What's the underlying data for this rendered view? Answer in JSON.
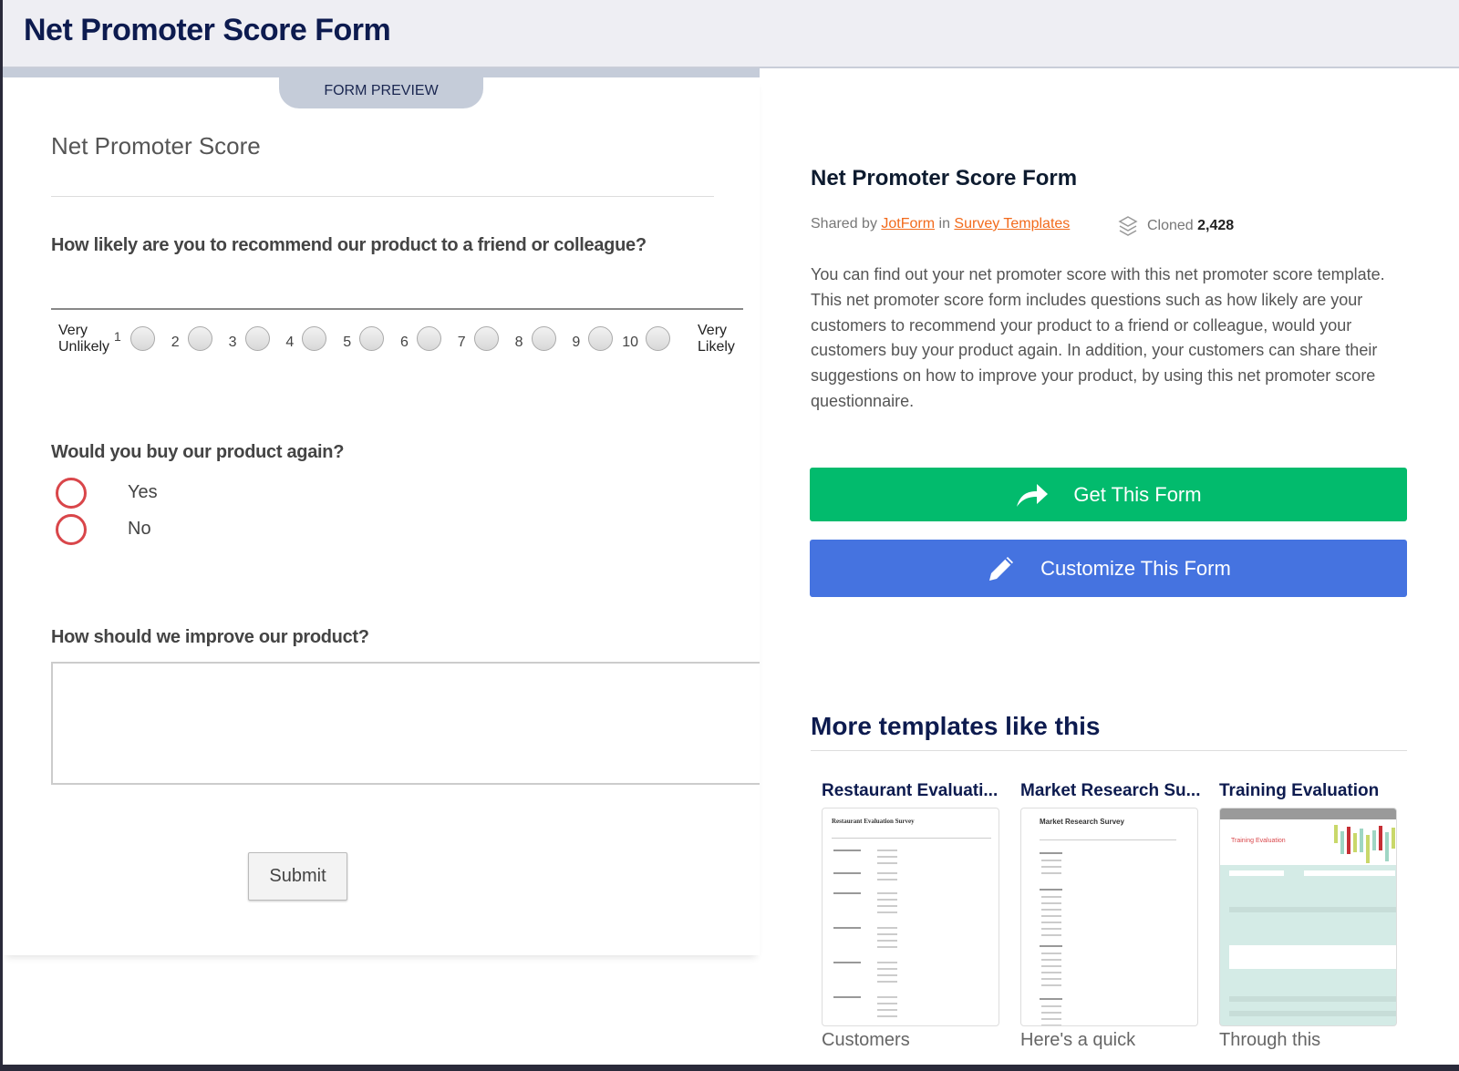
{
  "header": {
    "title": "Net Promoter Score Form"
  },
  "preview": {
    "tab_label": "FORM PREVIEW",
    "form_title": "Net Promoter Score",
    "q1": {
      "label": "How likely are you to recommend our product to a friend or colleague?",
      "low_label_1": "Very",
      "low_label_2": "Unlikely",
      "high_label_1": "Very",
      "high_label_2": "Likely",
      "options": [
        "1",
        "2",
        "3",
        "4",
        "5",
        "6",
        "7",
        "8",
        "9",
        "10"
      ]
    },
    "q2": {
      "label": "Would you buy our product again?",
      "options": [
        "Yes",
        "No"
      ],
      "accent": "#d9464a"
    },
    "q3": {
      "label": "How should we improve our product?",
      "value": ""
    },
    "submit_label": "Submit"
  },
  "details": {
    "title": "Net Promoter Score Form",
    "shared_by_prefix": "Shared by",
    "author": "JotForm",
    "in_word": "in",
    "category": "Survey Templates",
    "cloned_label": "Cloned",
    "cloned_count": "2,428",
    "description": "You can find out your net promoter score with this net promoter score template. This net promoter score form includes questions such as how likely are your customers to recommend your product to a friend or colleague, would your customers buy your product again. In addition, your customers can share their suggestions on how to improve your product, by using this net promoter score questionnaire.",
    "get_label": "Get This Form",
    "customize_label": "Customize This Form",
    "colors": {
      "get": "#02bb6d",
      "customize": "#4573e0",
      "link": "#f26a1b"
    }
  },
  "more": {
    "heading": "More templates like this",
    "cards": [
      {
        "title": "Restaurant Evaluati...",
        "thumb_title": "Restaurant Evaluation Survey",
        "caption": "Customers"
      },
      {
        "title": "Market Research Su...",
        "thumb_title": "Market Research Survey",
        "caption": "Here's a quick"
      },
      {
        "title": "Training Evaluation",
        "thumb_title": "Training Evaluation",
        "caption": "Through this"
      }
    ]
  }
}
